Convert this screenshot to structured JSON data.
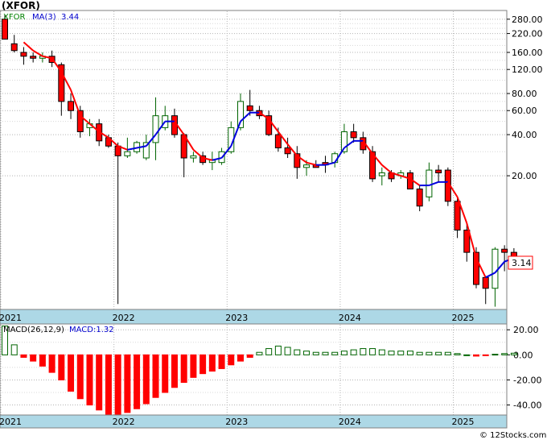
{
  "title": "(XFOR)",
  "footer": "© 12Stocks.com",
  "colors": {
    "up": "#ffffff",
    "up_border": "#006400",
    "down": "#ff0000",
    "down_border": "#000000",
    "ma_down": "#ff0000",
    "ma_up": "#0000dd",
    "grid": "#b4b4b4",
    "axis_band": "#add8e6",
    "macd_pos": "#ffffff",
    "macd_pos_border": "#006400",
    "macd_neg": "#ff0000",
    "legend_ticker": "#008000",
    "legend_value": "#0000cc"
  },
  "price_legend": {
    "ticker": "XFOR",
    "ma_label": "MA(3)",
    "ma_value": "3.44"
  },
  "macd_legend": {
    "label": "MACD(26,12,9)",
    "value_label": "MACD:1.32"
  },
  "last_price_label": "3.14",
  "chart_data": [
    {
      "type": "candlestick",
      "title": "(XFOR)",
      "scale": "log",
      "ylim": [
        2.1,
        320
      ],
      "yticks": [
        280,
        220,
        160,
        120,
        80,
        60,
        40,
        20
      ],
      "ytick_labels": [
        "280.00",
        "220.00",
        "160.00",
        "120.00",
        "80.00",
        "60.00",
        "40.00",
        "20.00"
      ],
      "x_labels": [
        "2021",
        "2022",
        "2023",
        "2024",
        "2025"
      ],
      "x_label_months": [
        0,
        12,
        24,
        36,
        48
      ],
      "months": 53,
      "ohlc": [
        [
          280,
          300,
          200,
          200
        ],
        [
          185,
          215,
          160,
          165
        ],
        [
          160,
          175,
          130,
          150
        ],
        [
          150,
          160,
          135,
          145
        ],
        [
          145,
          160,
          135,
          150
        ],
        [
          150,
          165,
          125,
          135
        ],
        [
          130,
          135,
          55,
          70
        ],
        [
          70,
          80,
          52,
          60
        ],
        [
          60,
          65,
          38,
          42
        ],
        [
          45,
          52,
          39,
          48
        ],
        [
          48,
          52,
          33,
          36
        ],
        [
          38,
          40,
          32,
          33
        ],
        [
          33,
          35,
          2.3,
          28
        ],
        [
          28,
          38,
          27,
          30
        ],
        [
          30,
          36,
          29,
          35
        ],
        [
          27,
          40,
          26,
          35
        ],
        [
          35,
          75,
          26,
          55
        ],
        [
          45,
          65,
          43,
          55
        ],
        [
          55,
          62,
          38,
          40
        ],
        [
          40,
          41,
          19.5,
          27
        ],
        [
          27,
          30,
          25,
          28
        ],
        [
          28,
          30,
          24,
          25
        ],
        [
          25,
          30,
          22,
          26
        ],
        [
          25,
          32,
          24,
          30
        ],
        [
          30,
          50,
          29,
          45
        ],
        [
          45,
          80,
          43,
          70
        ],
        [
          65,
          85,
          55,
          60
        ],
        [
          60,
          65,
          52,
          55
        ],
        [
          55,
          60,
          39,
          40
        ],
        [
          40,
          45,
          30,
          32
        ],
        [
          32,
          38,
          27,
          29
        ],
        [
          29,
          33,
          19,
          23
        ],
        [
          23,
          26,
          20,
          24
        ],
        [
          24,
          26,
          23,
          23
        ],
        [
          25,
          28,
          21,
          24
        ],
        [
          25,
          30,
          23,
          29
        ],
        [
          30,
          48,
          29,
          42
        ],
        [
          42,
          48,
          35,
          38
        ],
        [
          38,
          42,
          29,
          31
        ],
        [
          30,
          33,
          18,
          19
        ],
        [
          20,
          23,
          17,
          21
        ],
        [
          21,
          22,
          18,
          19
        ],
        [
          20,
          22,
          19,
          21
        ],
        [
          21,
          22,
          16,
          16
        ],
        [
          16,
          17,
          11,
          12
        ],
        [
          14,
          25,
          13,
          22
        ],
        [
          22,
          24,
          18,
          21
        ],
        [
          22,
          23,
          12,
          13
        ],
        [
          13,
          14,
          7,
          8
        ],
        [
          8,
          9,
          4.7,
          5.5
        ],
        [
          5.5,
          6,
          3,
          3.2
        ],
        [
          3.6,
          3.7,
          2.3,
          3.0
        ],
        [
          3.0,
          6.0,
          2.2,
          5.8
        ],
        [
          5.8,
          6.2,
          4.0,
          5.5
        ],
        [
          5.5,
          5.9,
          4.8,
          5.0
        ]
      ],
      "ma3": [
        null,
        null,
        190,
        165,
        150,
        145,
        115,
        85,
        55,
        48,
        42,
        38,
        33,
        31,
        32,
        33,
        40,
        50,
        50,
        40,
        31,
        27,
        26,
        27,
        33,
        50,
        58,
        58,
        52,
        42,
        34,
        28,
        25,
        24,
        24,
        25,
        32,
        36,
        36,
        29,
        24,
        21,
        20,
        19,
        17,
        17,
        18,
        18,
        14,
        9,
        5,
        3.6,
        3.9,
        4.7,
        5.0
      ],
      "ma_color_change_index": 30
    },
    {
      "type": "bar",
      "title": "MACD(26,12,9)",
      "ylim": [
        -48,
        24
      ],
      "yticks": [
        20,
        0,
        -20,
        -40
      ],
      "ytick_labels": [
        "20.00",
        "0.00",
        "-20.00",
        "-40.00"
      ],
      "x_labels": [
        "2021",
        "2022",
        "2023",
        "2024",
        "2025"
      ],
      "values": [
        23,
        8,
        -2,
        -5,
        -9,
        -14,
        -20,
        -29,
        -35,
        -40,
        -44,
        -48,
        -48,
        -46,
        -43,
        -39,
        -34,
        -30,
        -26,
        -22,
        -18,
        -15,
        -13,
        -11,
        -8,
        -5,
        -2,
        2,
        5,
        7,
        6,
        4,
        3,
        2,
        2,
        2,
        3,
        4,
        5,
        5,
        4,
        3,
        3,
        3,
        2,
        2,
        2,
        2,
        1,
        0,
        -1,
        -0.5,
        0.5,
        1,
        1.32
      ]
    }
  ]
}
